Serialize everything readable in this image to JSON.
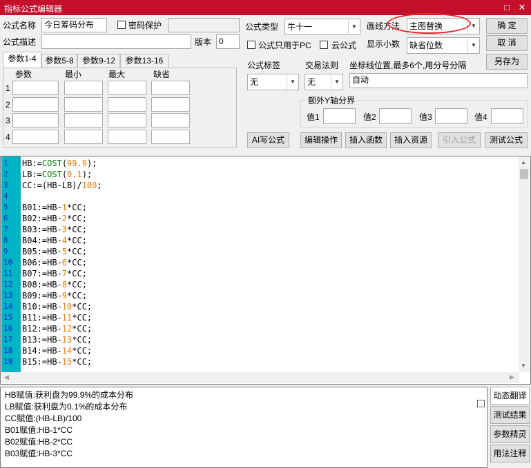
{
  "window": {
    "title": "指标公式编辑器",
    "help_glyph": "□",
    "close_glyph": "✕"
  },
  "form": {
    "name_label": "公式名称",
    "name_value": "今日筹码分布",
    "password_label": "密码保护",
    "desc_label": "公式描述",
    "desc_value": "",
    "version_label": "版本",
    "version_value": "0",
    "type_label": "公式类型",
    "type_value": "牛十一",
    "draw_label": "画线方法",
    "draw_value": "主图替换",
    "pc_only_label": "公式只用于PC",
    "cloud_label": "云公式",
    "decimals_label": "显示小数",
    "decimals_value": "缺省位数",
    "tag_label": "公式标签",
    "tag_value": "无",
    "trade_label": "交易法则",
    "trade_value": "无",
    "coord_label": "坐标线位置,最多6个,用分号分隔",
    "coord_value": "自动",
    "yaxis_group": "额外Y轴分界",
    "y_labels": [
      "值1",
      "值2",
      "值3",
      "值4"
    ]
  },
  "buttons": {
    "ok": "确 定",
    "cancel": "取 消",
    "save_as": "另存为",
    "ai": "AI写公式",
    "edit": "编辑操作",
    "insert_fn": "插入函数",
    "insert_res": "插入资源",
    "import": "引入公式",
    "test": "测试公式"
  },
  "tabs": [
    "参数1-4",
    "参数5-8",
    "参数9-12",
    "参数13-16"
  ],
  "param_headers": [
    "参数",
    "最小",
    "最大",
    "缺省"
  ],
  "param_rows": [
    "1",
    "2",
    "3",
    "4"
  ],
  "code_lines": [
    {
      "n": "1",
      "t": [
        [
          "",
          "HB:="
        ],
        [
          "fn",
          "COST"
        ],
        [
          "",
          "("
        ],
        [
          "num",
          "99.9"
        ],
        [
          "",
          ");"
        ]
      ]
    },
    {
      "n": "2",
      "t": [
        [
          "",
          "LB:="
        ],
        [
          "fn",
          "COST"
        ],
        [
          "",
          "("
        ],
        [
          "num",
          "0.1"
        ],
        [
          "",
          ");"
        ]
      ]
    },
    {
      "n": "3",
      "t": [
        [
          "",
          "CC:=(HB-LB)/"
        ],
        [
          "num",
          "100"
        ],
        [
          "",
          ";"
        ]
      ]
    },
    {
      "n": "4",
      "t": []
    },
    {
      "n": "5",
      "t": [
        [
          "",
          "B01:=HB-"
        ],
        [
          "num",
          "1"
        ],
        [
          "",
          "*CC;"
        ]
      ]
    },
    {
      "n": "6",
      "t": [
        [
          "",
          "B02:=HB-"
        ],
        [
          "num",
          "2"
        ],
        [
          "",
          "*CC;"
        ]
      ]
    },
    {
      "n": "7",
      "t": [
        [
          "",
          "B03:=HB-"
        ],
        [
          "num",
          "3"
        ],
        [
          "",
          "*CC;"
        ]
      ]
    },
    {
      "n": "8",
      "t": [
        [
          "",
          "B04:=HB-"
        ],
        [
          "num",
          "4"
        ],
        [
          "",
          "*CC;"
        ]
      ]
    },
    {
      "n": "9",
      "t": [
        [
          "",
          "B05:=HB-"
        ],
        [
          "num",
          "5"
        ],
        [
          "",
          "*CC;"
        ]
      ]
    },
    {
      "n": "10",
      "t": [
        [
          "",
          "B06:=HB-"
        ],
        [
          "num",
          "6"
        ],
        [
          "",
          "*CC;"
        ]
      ]
    },
    {
      "n": "11",
      "t": [
        [
          "",
          "B07:=HB-"
        ],
        [
          "num",
          "7"
        ],
        [
          "",
          "*CC;"
        ]
      ]
    },
    {
      "n": "12",
      "t": [
        [
          "",
          "B08:=HB-"
        ],
        [
          "num",
          "8"
        ],
        [
          "",
          "*CC;"
        ]
      ]
    },
    {
      "n": "13",
      "t": [
        [
          "",
          "B09:=HB-"
        ],
        [
          "num",
          "9"
        ],
        [
          "",
          "*CC;"
        ]
      ]
    },
    {
      "n": "14",
      "t": [
        [
          "",
          "B10:=HB-"
        ],
        [
          "num",
          "10"
        ],
        [
          "",
          "*CC;"
        ]
      ]
    },
    {
      "n": "15",
      "t": [
        [
          "",
          "B11:=HB-"
        ],
        [
          "num",
          "11"
        ],
        [
          "",
          "*CC;"
        ]
      ]
    },
    {
      "n": "16",
      "t": [
        [
          "",
          "B12:=HB-"
        ],
        [
          "num",
          "12"
        ],
        [
          "",
          "*CC;"
        ]
      ]
    },
    {
      "n": "17",
      "t": [
        [
          "",
          "B13:=HB-"
        ],
        [
          "num",
          "13"
        ],
        [
          "",
          "*CC;"
        ]
      ]
    },
    {
      "n": "18",
      "t": [
        [
          "",
          "B14:=HB-"
        ],
        [
          "num",
          "14"
        ],
        [
          "",
          "*CC;"
        ]
      ]
    },
    {
      "n": "19",
      "t": [
        [
          "",
          "B15:=HB-"
        ],
        [
          "num",
          "15"
        ],
        [
          "",
          "*CC;"
        ]
      ]
    }
  ],
  "desc_lines": [
    "HB赋值:获利盘为99.9%的成本分布",
    "LB赋值:获利盘为0.1%的成本分布",
    "CC赋值:(HB-LB)/100",
    "B01赋值:HB-1*CC",
    "B02赋值:HB-2*CC",
    "B03赋值:HB-3*CC"
  ],
  "side_buttons": [
    "动态翻译",
    "测试结果",
    "参数精灵",
    "用法注释"
  ],
  "colors": {
    "title_bar": "#c3102b",
    "gutter": "#00b3c4",
    "number": "#e07800",
    "function": "#007a00",
    "line_no": "#1b2fcf"
  }
}
